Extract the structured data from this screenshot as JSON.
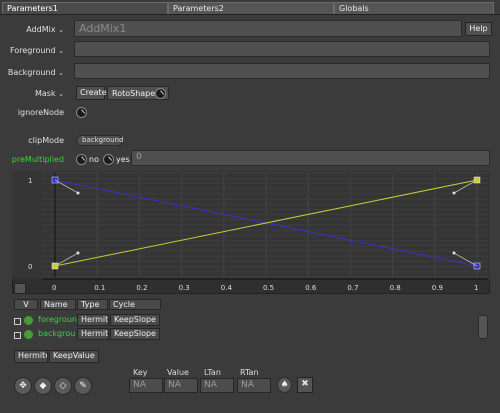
{
  "tabs": [
    {
      "label": "Parameters1"
    },
    {
      "label": "Parameters2"
    },
    {
      "label": "Globals"
    }
  ],
  "rows": {
    "addmix": {
      "label": "AddMix",
      "value": "AddMix1",
      "help": "Help"
    },
    "foreground": {
      "label": "Foreground",
      "value": ""
    },
    "background": {
      "label": "Background",
      "value": ""
    },
    "mask": {
      "label": "Mask",
      "create": "Create",
      "value": "RotoShape"
    },
    "ignore": {
      "label": "ignoreNode"
    },
    "clipmode": {
      "label": "clipMode",
      "value": "background"
    },
    "premult": {
      "label": "preMultiplied",
      "no": "no",
      "yes": "yes",
      "value": "0"
    }
  },
  "graph": {
    "y_ticks": [
      "1",
      "0"
    ],
    "x_ticks": [
      "0",
      "0.1",
      "0.2",
      "0.3",
      "0.4",
      "0.5",
      "0.6",
      "0.7",
      "0.8",
      "0.9",
      "1"
    ],
    "colors": {
      "blue": "#3333cc",
      "yellow": "#cccc33",
      "grid": "#454545"
    }
  },
  "chart_data": {
    "type": "line",
    "title": "",
    "xlabel": "",
    "ylabel": "",
    "xlim": [
      0,
      1
    ],
    "ylim": [
      0,
      1
    ],
    "series": [
      {
        "name": "",
        "color": "#3333cc",
        "x": [
          0,
          1
        ],
        "values": [
          1,
          0
        ]
      },
      {
        "name": "",
        "color": "#cccc33",
        "x": [
          0,
          1
        ],
        "values": [
          0,
          1
        ]
      }
    ]
  },
  "table": {
    "headers": [
      "V",
      "Name",
      "Type",
      "Cycle"
    ],
    "rows": [
      {
        "name": "foregroun",
        "type": "Hermite",
        "cycle": "KeepSlope"
      },
      {
        "name": "backgrou",
        "type": "Hermite",
        "cycle": "KeepSlope"
      }
    ],
    "footer": {
      "type": "Hermite",
      "cycle": "KeepValue"
    }
  },
  "keyframe": {
    "labels": [
      "Key",
      "Value",
      "LTan",
      "RTan"
    ],
    "values": [
      "NA",
      "NA",
      "NA",
      "NA"
    ]
  },
  "toolbar_icons": [
    "tool-1-icon",
    "tool-2-icon",
    "tool-3-icon",
    "tool-4-icon"
  ]
}
